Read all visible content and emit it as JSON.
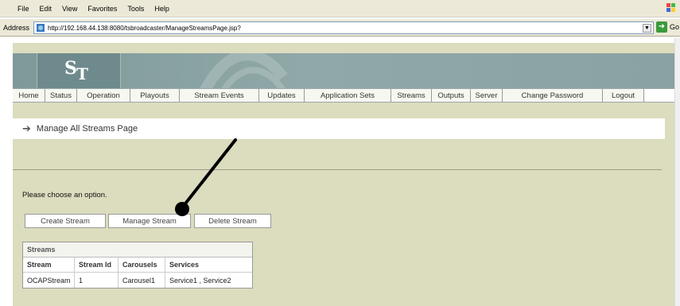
{
  "browser": {
    "menu": [
      "File",
      "Edit",
      "View",
      "Favorites",
      "Tools",
      "Help"
    ],
    "address_label": "Address",
    "url": "http://192.168.44.138:8080/tsbroadcaster/ManageStreamsPage.jsp?",
    "go_label": "Go"
  },
  "app": {
    "logo": {
      "s": "S",
      "t": "T"
    },
    "nav": [
      "Home",
      "Status",
      "Operation",
      "Playouts",
      "Stream Events",
      "Updates",
      "Application Sets",
      "Streams",
      "Outputs",
      "Server",
      "Change Password",
      "Logout"
    ],
    "page_title": "Manage All Streams Page",
    "prompt": "Please choose an option.",
    "buttons": {
      "create": "Create Stream",
      "manage": "Manage Stream",
      "delete": "Delete Stream"
    },
    "table": {
      "caption": "Streams",
      "headers": [
        "Stream",
        "Stream Id",
        "Carousels",
        "Services"
      ],
      "rows": [
        [
          "OCAPStream",
          "1",
          "Carousel1",
          "Service1 , Service2"
        ]
      ]
    }
  },
  "colors": {
    "page_bg": "#dcdcbe",
    "banner": "#8aa2a2",
    "annotation": "#000000"
  }
}
